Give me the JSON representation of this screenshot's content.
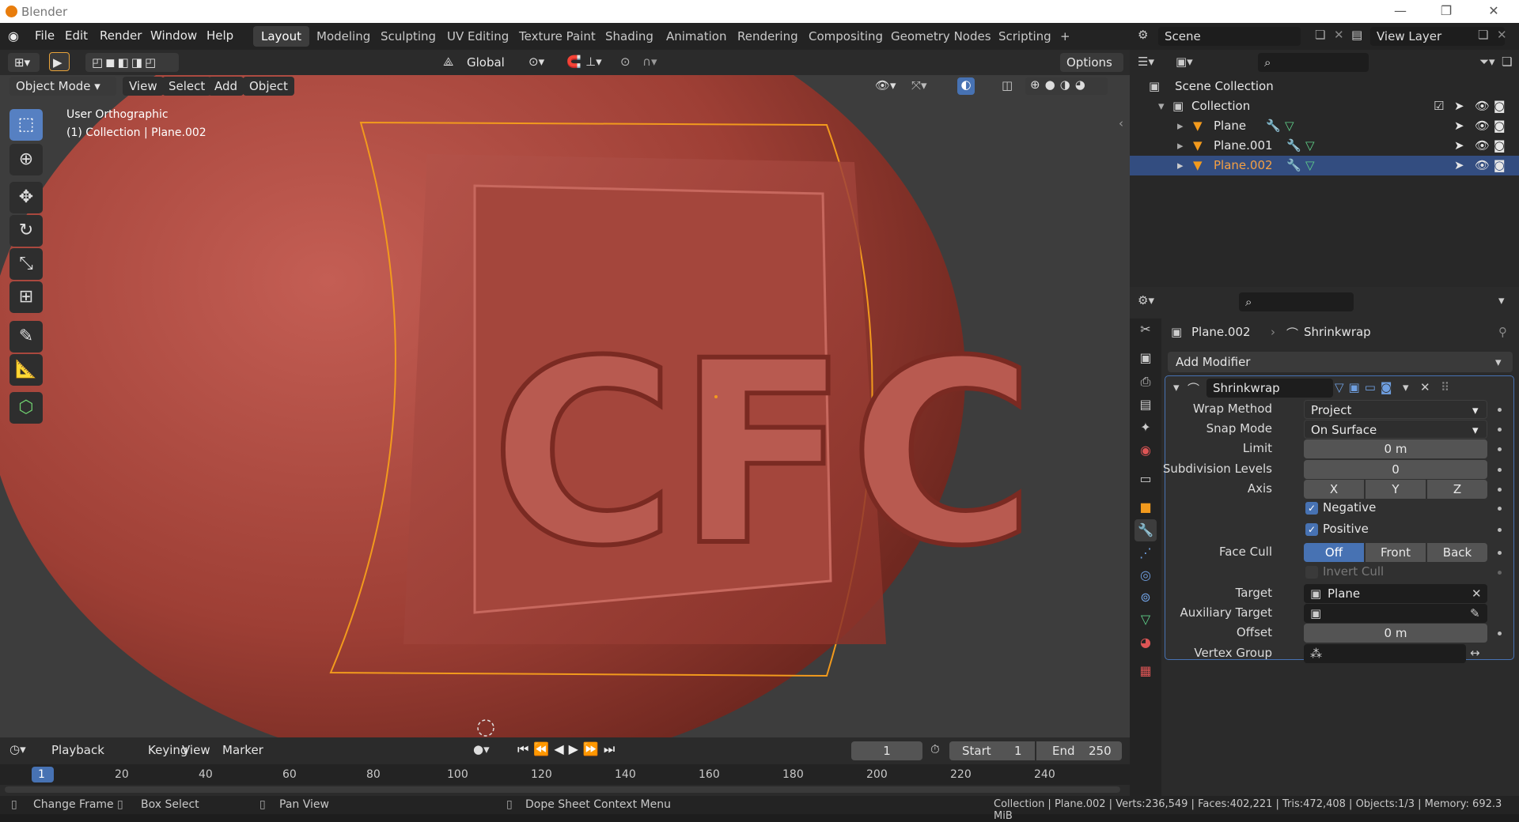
{
  "window": {
    "title": "Blender"
  },
  "menu": [
    "File",
    "Edit",
    "Render",
    "Window",
    "Help"
  ],
  "workspaces": [
    "Layout",
    "Modeling",
    "Sculpting",
    "UV Editing",
    "Texture Paint",
    "Shading",
    "Animation",
    "Rendering",
    "Compositing",
    "Geometry Nodes",
    "Scripting",
    "+"
  ],
  "scene": {
    "name": "Scene",
    "view_layer": "View Layer"
  },
  "tool_header": {
    "transform_orientation": "Global",
    "options": "Options"
  },
  "viewport_header": {
    "mode": "Object Mode",
    "menus": [
      "View",
      "Select",
      "Add",
      "Object"
    ]
  },
  "viewport": {
    "view_name": "User Orthographic",
    "context": "(1) Collection | Plane.002",
    "text_on_object": "CFC"
  },
  "outliner": {
    "scene_collection": "Scene Collection",
    "collection": "Collection",
    "objects": [
      {
        "name": "Plane",
        "selected": false
      },
      {
        "name": "Plane.001",
        "selected": false
      },
      {
        "name": "Plane.002",
        "selected": true
      }
    ]
  },
  "properties": {
    "object": "Plane.002",
    "modifier_context": "Shrinkwrap",
    "add_modifier": "Add Modifier",
    "modifier": {
      "name": "Shrinkwrap",
      "wrap_method_label": "Wrap Method",
      "wrap_method": "Project",
      "snap_mode_label": "Snap Mode",
      "snap_mode": "On Surface",
      "limit_label": "Limit",
      "limit": "0 m",
      "subdiv_label": "Subdivision Levels",
      "subdiv": "0",
      "axis_label": "Axis",
      "axes": [
        "X",
        "Y",
        "Z"
      ],
      "negative": "Negative",
      "positive": "Positive",
      "face_cull_label": "Face Cull",
      "face_cull": [
        "Off",
        "Front",
        "Back"
      ],
      "face_cull_active": "Off",
      "invert_cull": "Invert Cull",
      "target_label": "Target",
      "target": "Plane",
      "aux_target_label": "Auxiliary Target",
      "aux_target": "",
      "offset_label": "Offset",
      "offset": "0 m",
      "vertex_group_label": "Vertex Group",
      "vertex_group": ""
    }
  },
  "timeline": {
    "menus": [
      "Playback",
      "Keying",
      "View",
      "Marker"
    ],
    "current_frame": "1",
    "start_label": "Start",
    "start": "1",
    "end_label": "End",
    "end": "250",
    "ticks": [
      "1",
      "20",
      "40",
      "60",
      "80",
      "100",
      "120",
      "140",
      "160",
      "180",
      "200",
      "220",
      "240"
    ]
  },
  "statusbar": {
    "left": [
      "Change Frame",
      "Box Select",
      "Pan View",
      "Dope Sheet Context Menu"
    ],
    "right": "Collection | Plane.002 | Verts:236,549 | Faces:402,221 | Tris:472,408 | Objects:1/3 | Memory: 692.3 MiB"
  },
  "colors": {
    "accent": "#4772b3",
    "selection_orange": "#f29a1d",
    "object": "#b34a3e"
  }
}
